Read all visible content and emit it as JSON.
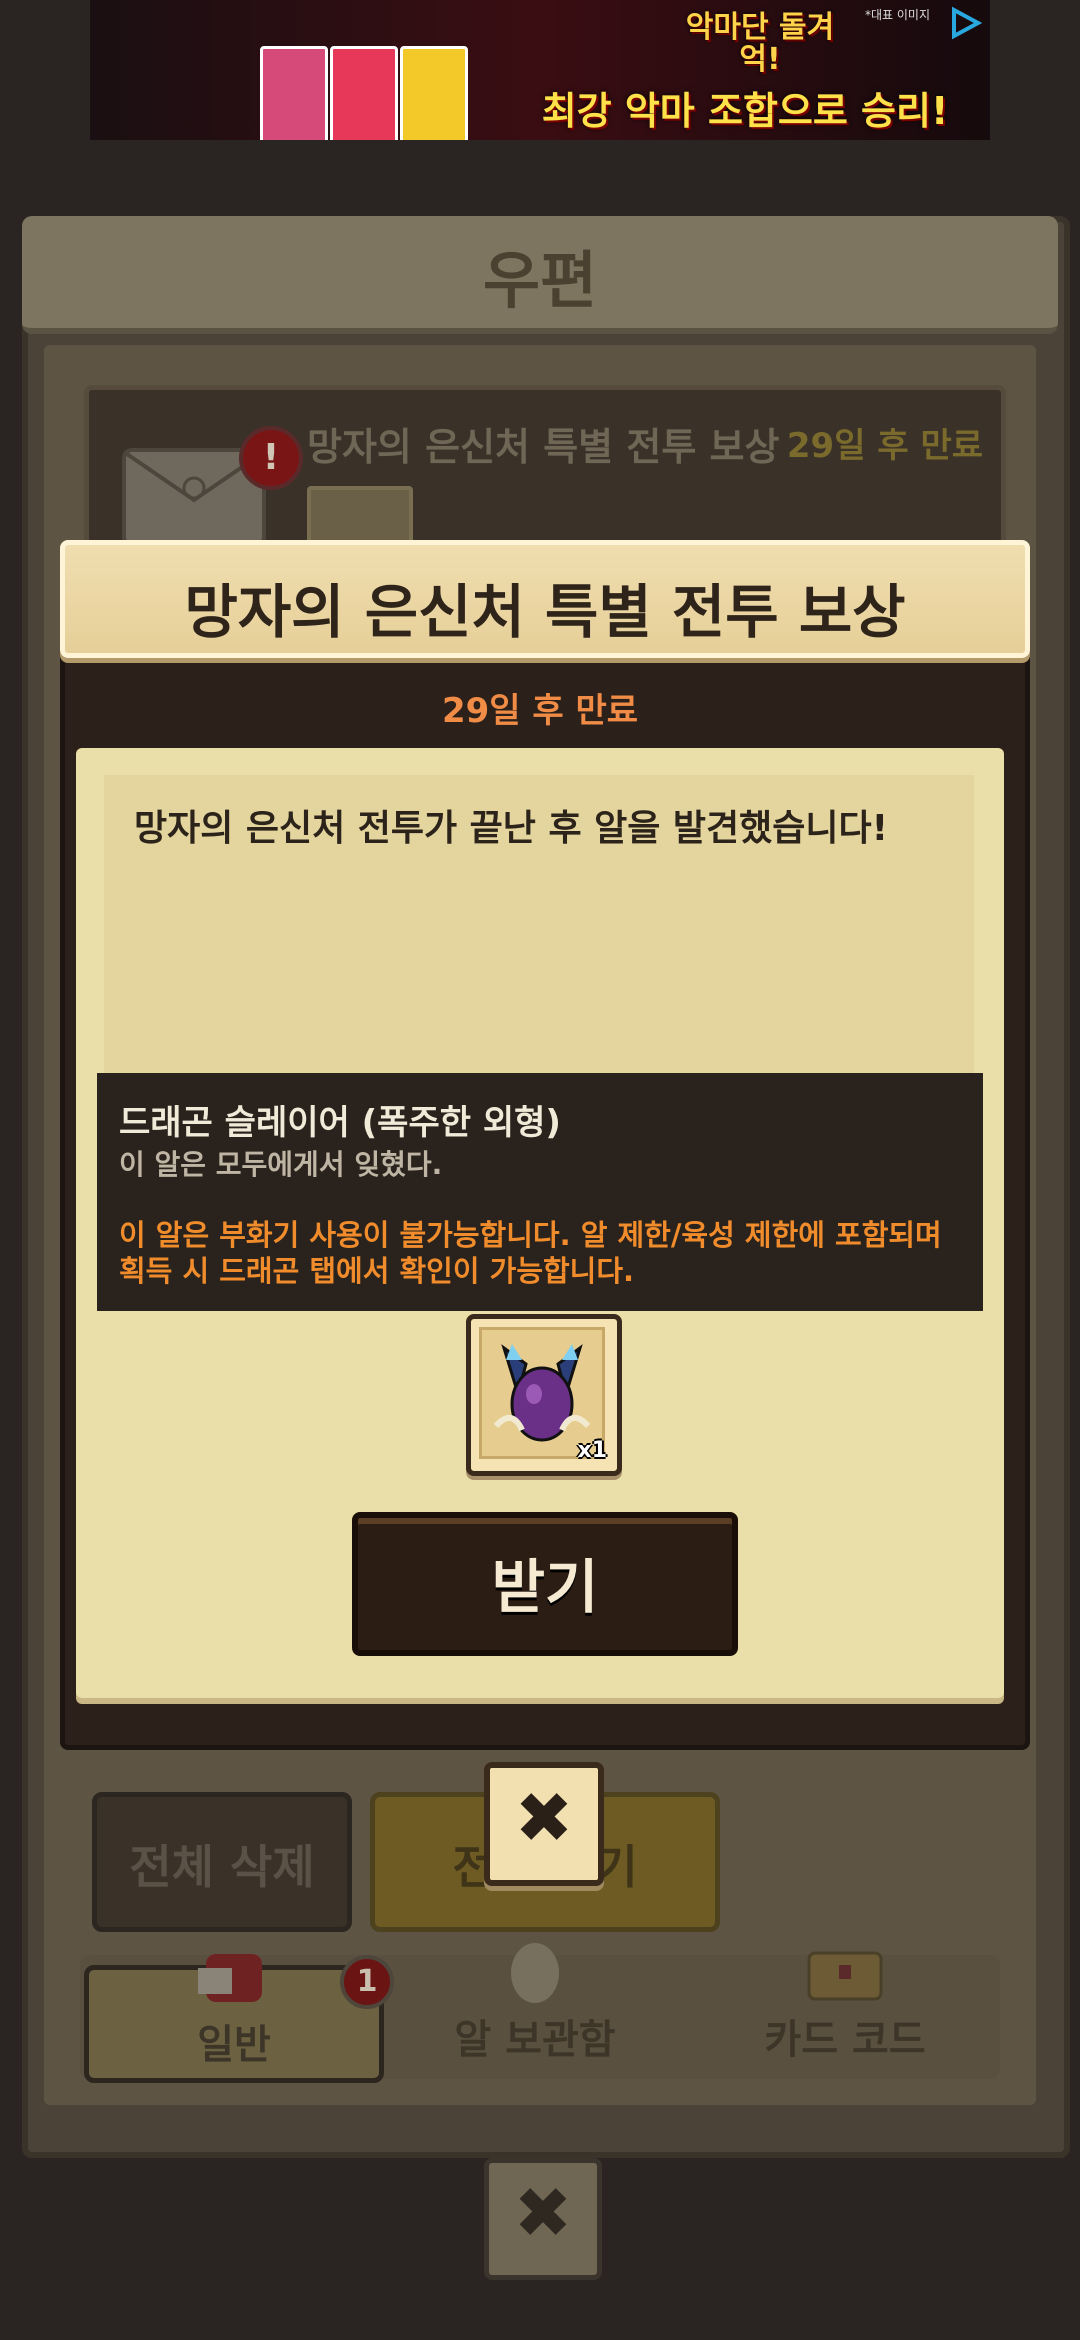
{
  "ad": {
    "title": "악마단 돌겨억!",
    "subtitle": "최강 악마 조합으로 승리!",
    "notice": "*대표 이미지"
  },
  "mail": {
    "title": "우편",
    "item": {
      "title": "망자의 은신처 특별 전투 보상",
      "expire": "29일 후 만료",
      "alert": "!"
    },
    "buttons": {
      "delete_all": "전체 삭제",
      "receive_all": "전체 받기"
    },
    "tabs": [
      {
        "label": "일반",
        "icon": "mail-bag-icon",
        "badge": "1"
      },
      {
        "label": "알 보관함",
        "icon": "egg-icon"
      },
      {
        "label": "카드 코드",
        "icon": "treasure-chest-icon"
      }
    ]
  },
  "modal": {
    "title": "망자의 은신처 특별 전투 보상",
    "expire": "29일 후 만료",
    "message": "망자의 은신처 전투가 끝난 후 알을 발견했습니다!",
    "tooltip": {
      "name": "드래곤 슬레이어 (폭주한 외형)",
      "description": "이 알은 모두에게서 잊혔다.",
      "warning_line1": "이 알은 부화기 사용이 불가능합니다. 알 제한/육성 제한에 포함되며",
      "warning_line2": "획득 시 드래곤 탭에서 확인이 가능합니다."
    },
    "reward": {
      "icon": "dragon-egg-icon",
      "quantity": "x1"
    },
    "receive_button": "받기",
    "close_icon": "close-icon"
  },
  "colors": {
    "expire_orange": "#f08c46",
    "warning_orange": "#f08c2c",
    "modal_header": "#e6cf98",
    "paper": "#ebdfa9",
    "dark_button": "#2b1d14"
  }
}
